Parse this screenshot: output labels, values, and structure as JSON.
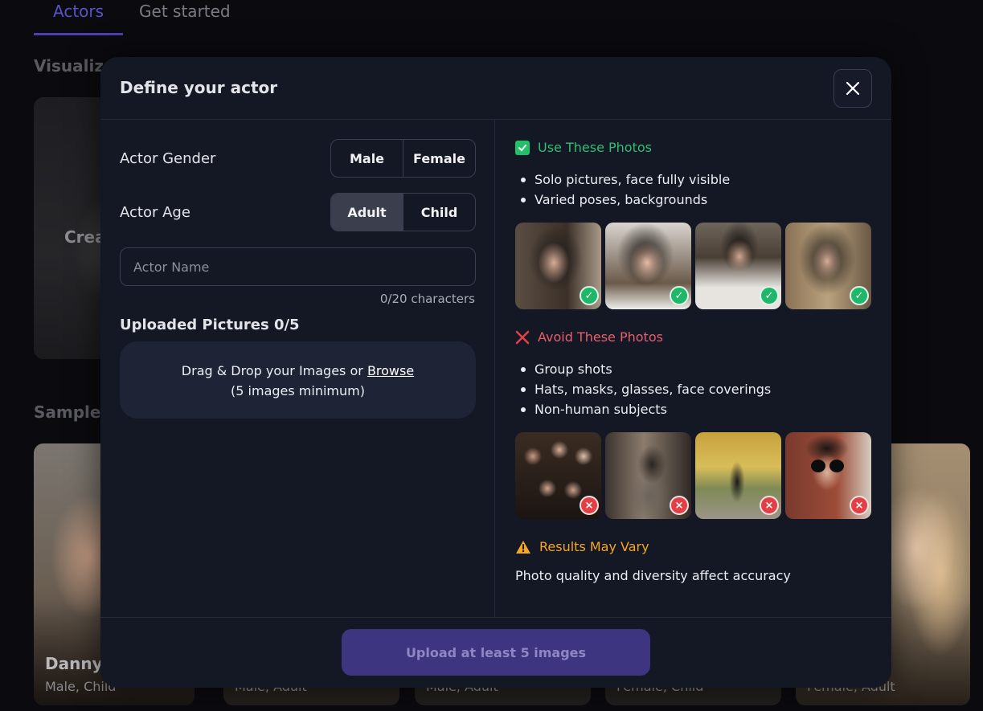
{
  "tabs": [
    {
      "label": "Actors"
    },
    {
      "label": "Get started"
    }
  ],
  "background": {
    "visualize_heading": "Visualize",
    "create_label": "Crea",
    "sample_heading": "Sample A",
    "cards": [
      {
        "name": "Danny",
        "sub": "Male, Child"
      },
      {
        "name": "",
        "sub": "Male, Adult"
      },
      {
        "name": "",
        "sub": "Male, Adult"
      },
      {
        "name": "",
        "sub": "Female, Child"
      },
      {
        "name": "",
        "sub": "Female, Adult"
      }
    ]
  },
  "modal": {
    "title": "Define your actor",
    "close_icon": "close-icon",
    "gender": {
      "label": "Actor Gender",
      "options": [
        "Male",
        "Female"
      ],
      "selected": ""
    },
    "age": {
      "label": "Actor Age",
      "options": [
        "Adult",
        "Child"
      ],
      "selected": "Adult"
    },
    "name_field": {
      "placeholder": "Actor Name",
      "value": "",
      "counter": "0/20 characters"
    },
    "uploaded": {
      "title": "Uploaded Pictures 0/5"
    },
    "dropzone": {
      "text": "Drag & Drop your Images or ",
      "browse": "Browse",
      "minimum": "(5 images minimum)"
    },
    "use": {
      "heading": "Use These Photos",
      "bullets": [
        "Solo pictures, face fully visible",
        "Varied poses, backgrounds"
      ]
    },
    "avoid": {
      "heading": "Avoid These Photos",
      "bullets": [
        "Group shots",
        "Hats, masks, glasses, face coverings",
        "Non-human subjects"
      ]
    },
    "vary": {
      "heading": "Results May Vary",
      "text": "Photo quality and diversity affect accuracy"
    },
    "cta": "Upload at least 5 images"
  },
  "colors": {
    "accent": "#4b3fb3",
    "ok": "#22c068",
    "bad": "#e23f47",
    "warn": "#f5a623"
  }
}
